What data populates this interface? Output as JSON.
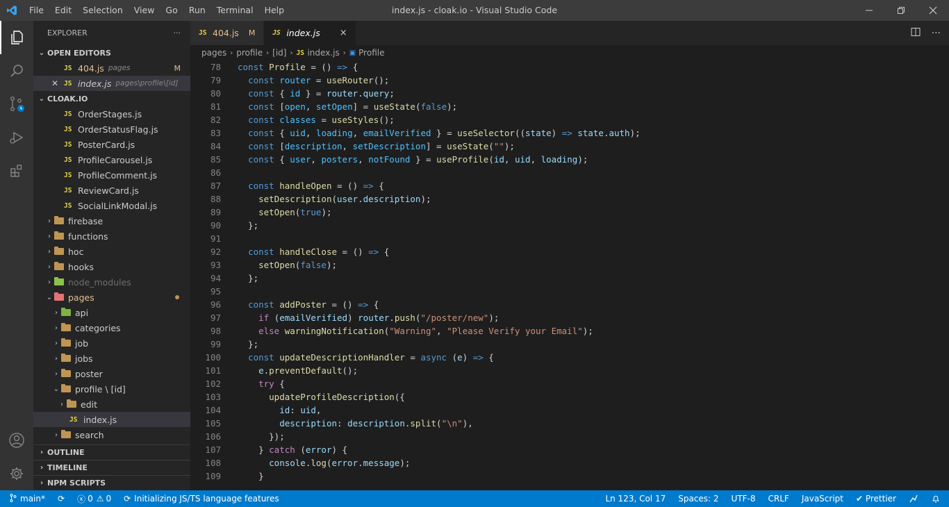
{
  "titlebar": {
    "menu": [
      "File",
      "Edit",
      "Selection",
      "View",
      "Go",
      "Run",
      "Terminal",
      "Help"
    ],
    "title": "index.js - cloak.io - Visual Studio Code"
  },
  "sidebar": {
    "header": "EXPLORER",
    "more": "···",
    "open_editors": {
      "label": "OPEN EDITORS",
      "items": [
        {
          "icon": "JS",
          "name": "404.js",
          "desc": "pages",
          "flag": "M"
        },
        {
          "icon": "JS",
          "name": "index.js",
          "desc": "pages\\profile\\[id]"
        }
      ]
    },
    "project": {
      "label": "CLOAK.IO",
      "files": [
        {
          "icon": "JS",
          "name": "OrderStages.js"
        },
        {
          "icon": "JS",
          "name": "OrderStatusFlag.js"
        },
        {
          "icon": "JS",
          "name": "PosterCard.js"
        },
        {
          "icon": "JS",
          "name": "ProfileCarousel.js"
        },
        {
          "icon": "JS",
          "name": "ProfileComment.js"
        },
        {
          "icon": "JS",
          "name": "ReviewCard.js"
        },
        {
          "icon": "JS",
          "name": "SocialLinkModal.js"
        }
      ],
      "folders": [
        "firebase",
        "functions",
        "hoc",
        "hooks",
        "node_modules"
      ],
      "pages": {
        "name": "pages",
        "children": [
          "api",
          "categories",
          "job",
          "jobs",
          "poster"
        ],
        "profile": {
          "name": "profile \\ [id]",
          "children": [
            "edit"
          ],
          "active_file": {
            "icon": "JS",
            "name": "index.js"
          }
        },
        "after": [
          "search"
        ]
      }
    },
    "bottom_sections": [
      "OUTLINE",
      "TIMELINE",
      "NPM SCRIPTS"
    ]
  },
  "tabs": [
    {
      "icon": "JS",
      "name": "404.js",
      "flag": "M"
    },
    {
      "icon": "JS",
      "name": "index.js",
      "close": "×"
    }
  ],
  "breadcrumb": [
    "pages",
    "profile",
    "[id]",
    "index.js",
    "Profile"
  ],
  "breadcrumb_js": "JS",
  "editor": {
    "line_numbers": [
      "78",
      "79",
      "80",
      "81",
      "82",
      "83",
      "84",
      "85",
      "86",
      "87",
      "88",
      "89",
      "90",
      "91",
      "92",
      "93",
      "94",
      "95",
      "96",
      "97",
      "98",
      "99",
      "100",
      "101",
      "102",
      "103",
      "104",
      "105",
      "106",
      "107",
      "108",
      "109"
    ]
  },
  "statusbar": {
    "branch": "main*",
    "sync": "⟳",
    "errors": "0",
    "warnings": "0",
    "message": "Initializing JS/TS language features",
    "position": "Ln 123, Col 17",
    "spaces": "Spaces: 2",
    "encoding": "UTF-8",
    "eol": "CRLF",
    "language": "JavaScript",
    "formatter": "✔ Prettier"
  },
  "colors": {
    "accent": "#007acc",
    "titlebar": "#3c3c3c",
    "sidebar": "#252526",
    "editor": "#1e1e1e"
  }
}
